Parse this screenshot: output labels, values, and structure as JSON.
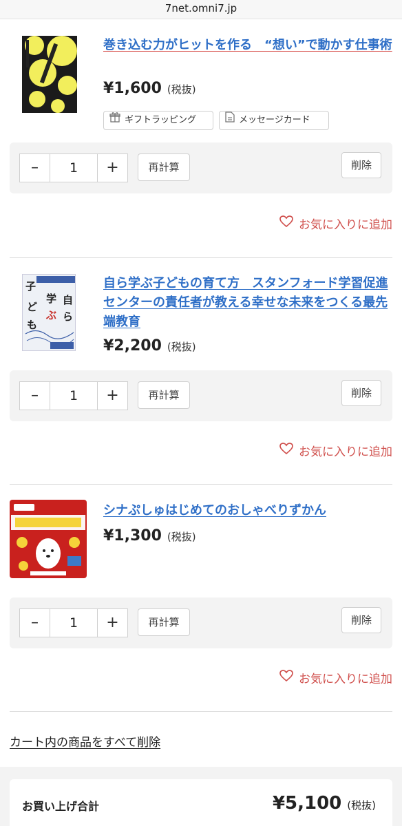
{
  "browser": {
    "url": "7net.omni7.jp"
  },
  "items": [
    {
      "title": "巻き込む力がヒットを作る　“想い”で動かす仕事術",
      "price": "¥1,600",
      "tax": "(税抜)",
      "cover_colors": {
        "bg": "#1b1b1b",
        "accent": "#f2ee5c"
      },
      "options": [
        {
          "label": "ギフトラッピング",
          "icon": "gift-icon"
        },
        {
          "label": "メッセージカード",
          "icon": "document-icon"
        }
      ],
      "quantity": "1",
      "minus_label": "–",
      "plus_label": "+",
      "recalc_label": "再計算",
      "delete_label": "削除",
      "favorite_label": "お気に入りに追加"
    },
    {
      "title": "自ら学ぶ子どもの育て方　スタンフォード学習促進センターの責任者が教える幸せな未来をつくる最先端教育",
      "price": "¥2,200",
      "tax": "(税抜)",
      "cover_colors": {
        "bg": "#eef1f6",
        "accent": "#3d5fa8",
        "text": "#c8322c"
      },
      "quantity": "1",
      "minus_label": "–",
      "plus_label": "+",
      "recalc_label": "再計算",
      "delete_label": "削除",
      "favorite_label": "お気に入りに追加"
    },
    {
      "title": "シナぷしゅはじめてのおしゃべりずかん",
      "price": "¥1,300",
      "tax": "(税抜)",
      "cover_colors": {
        "bg": "#c9211e",
        "accent": "#ffffff",
        "text": "#f5d33a"
      },
      "quantity": "1",
      "minus_label": "–",
      "plus_label": "+",
      "recalc_label": "再計算",
      "delete_label": "削除",
      "favorite_label": "お気に入りに追加"
    }
  ],
  "delete_all_label": "カート内の商品をすべて削除",
  "summary": {
    "label": "お買い上げ合計",
    "total": "¥5,100",
    "tax": "(税抜)"
  },
  "colors": {
    "link": "#2f6fc7",
    "favorite": "#d0504d",
    "panel": "#f3f3f3"
  }
}
